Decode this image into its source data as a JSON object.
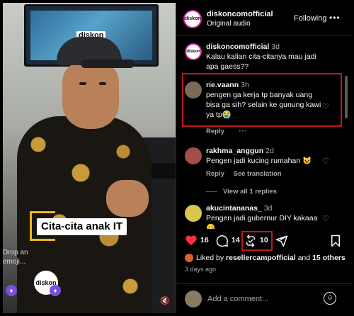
{
  "video": {
    "watermark": "diskon",
    "caption": "Cita-cita anak IT",
    "emoji_drop": "Drop an emoji...",
    "badge": "diskon"
  },
  "header": {
    "username": "diskoncomofficial",
    "audio": "Original audio",
    "follow_label": "Following",
    "more_label": "..."
  },
  "comments": [
    {
      "username": "diskoncomofficial",
      "time": "3d",
      "text": "Kalau kalian cita-citanya mau jadi apa gaess??"
    },
    {
      "username": "rie.vaann",
      "time": "3h",
      "text": "pengen ga kerja tp banyak uang bisa ga sih? selain ke gunung kawi ya tp😭",
      "reply_label": "Reply",
      "more_label": "···"
    },
    {
      "username": "rakhma_anggun",
      "time": "2d",
      "text": "Pengen jadi kucing rumahan 😺",
      "reply_label": "Reply",
      "translation_label": "See translation",
      "view_replies": "View all 1 replies"
    },
    {
      "username": "akucintananas_",
      "time": "3d",
      "text": "Pengen jadi gubernur DIY kakaaa 😊"
    }
  ],
  "actions": {
    "likes": "16",
    "comments": "14",
    "reposts": "10"
  },
  "liked_by": {
    "prefix": "Liked by",
    "user": "resellercampofficial",
    "joiner": "and",
    "others": "15 others"
  },
  "posted_ago": "3 days ago",
  "add_comment": {
    "placeholder": "Add a comment..."
  },
  "colors": {
    "highlight": "#c4161c",
    "like": "#ff3040"
  }
}
